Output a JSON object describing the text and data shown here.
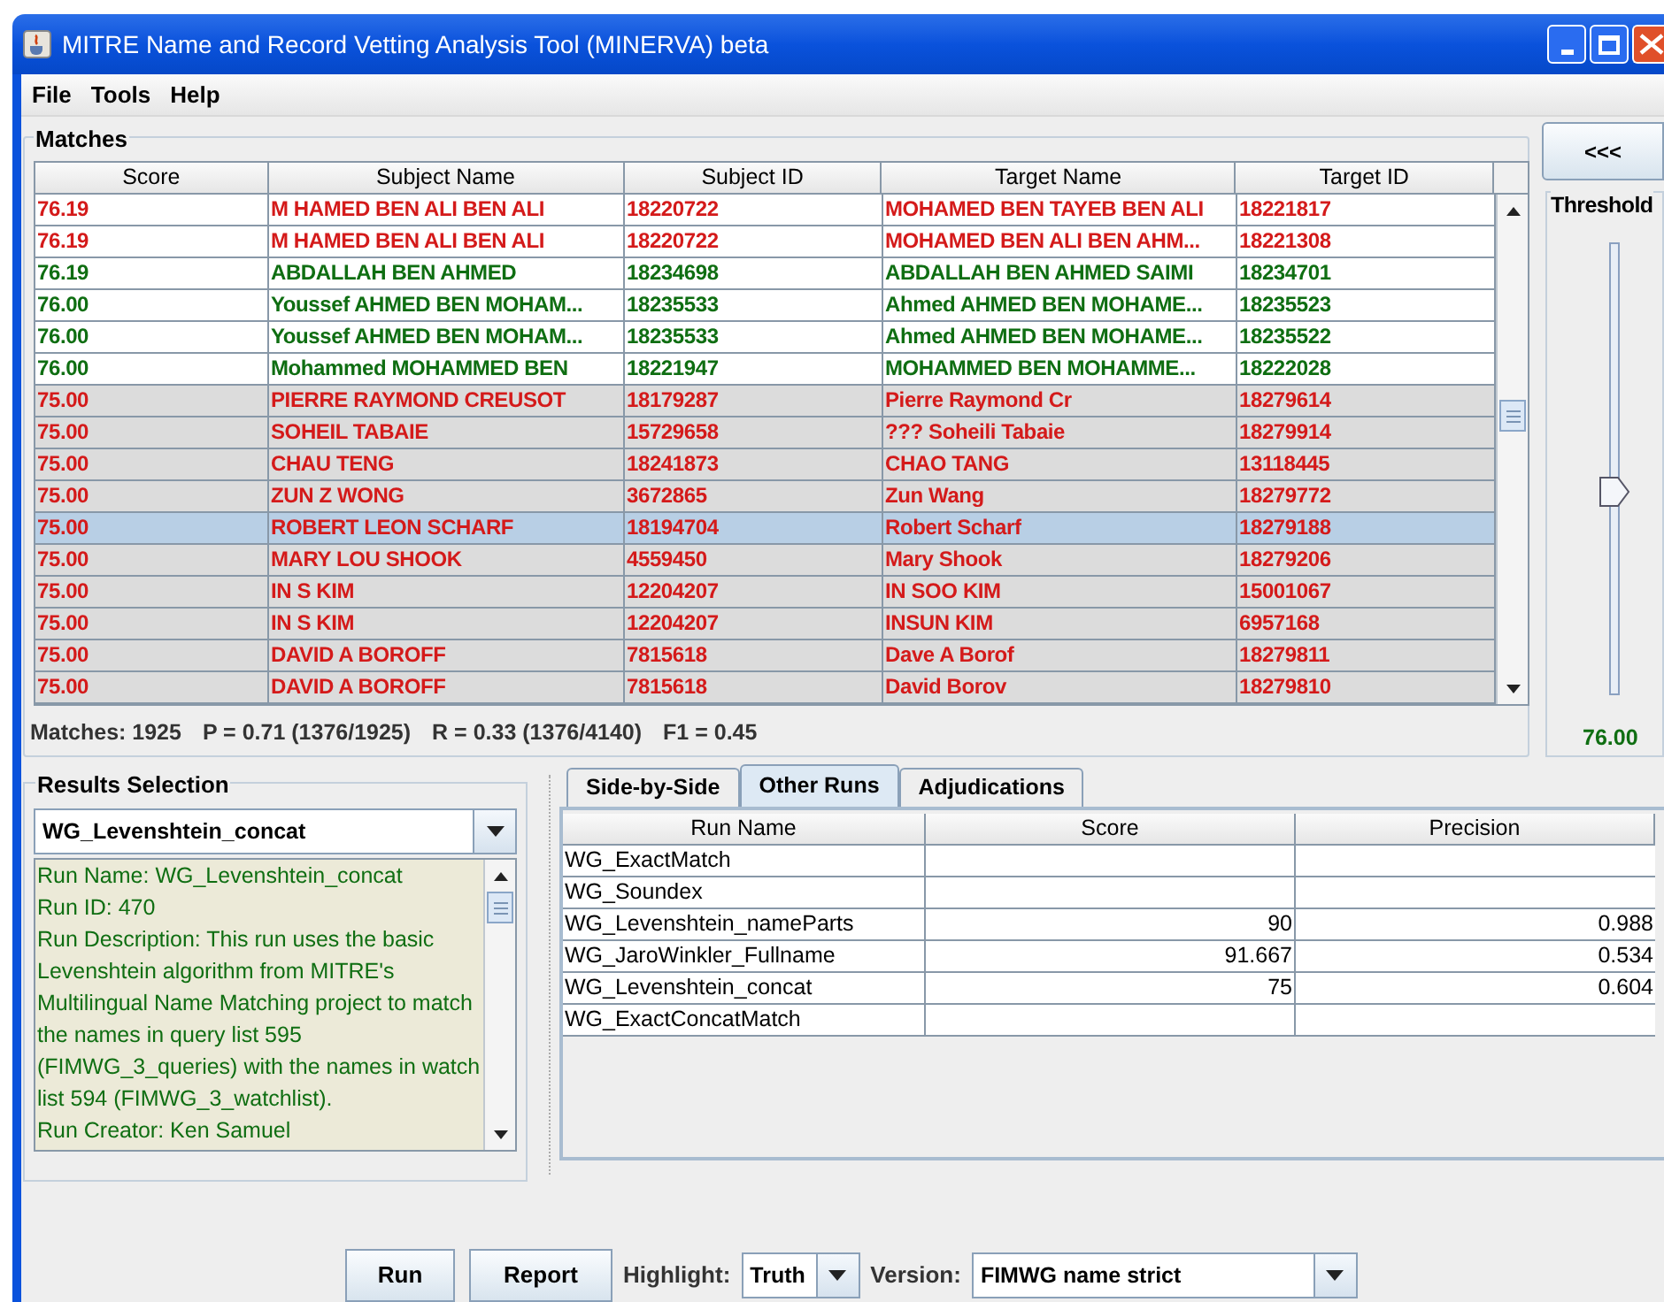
{
  "window": {
    "title": "MITRE Name and Record Vetting Analysis Tool (MINERVA) beta"
  },
  "menu": [
    "File",
    "Tools",
    "Help"
  ],
  "matches": {
    "title": "Matches",
    "columns": [
      "Score",
      "Subject Name",
      "Subject ID",
      "Target Name",
      "Target ID"
    ],
    "rows": [
      {
        "score": "76.19",
        "subject_name": "M HAMED BEN ALI BEN ALI",
        "subject_id": "18220722",
        "target_name": "MOHAMED BEN TAYEB BEN ALI",
        "target_id": "18221817",
        "color": "#d41a1a",
        "shaded": false,
        "selected": false
      },
      {
        "score": "76.19",
        "subject_name": "M HAMED BEN ALI BEN ALI",
        "subject_id": "18220722",
        "target_name": "MOHAMED BEN ALI BEN AHM...",
        "target_id": "18221308",
        "color": "#d41a1a",
        "shaded": false,
        "selected": false
      },
      {
        "score": "76.19",
        "subject_name": "ABDALLAH BEN AHMED",
        "subject_id": "18234698",
        "target_name": "ABDALLAH BEN AHMED SAIMI",
        "target_id": "18234701",
        "color": "#0f6e12",
        "shaded": false,
        "selected": false
      },
      {
        "score": "76.00",
        "subject_name": "Youssef AHMED BEN MOHAM...",
        "subject_id": "18235533",
        "target_name": "Ahmed AHMED BEN MOHAME...",
        "target_id": "18235523",
        "color": "#0f6e12",
        "shaded": false,
        "selected": false
      },
      {
        "score": "76.00",
        "subject_name": "Youssef AHMED BEN MOHAM...",
        "subject_id": "18235533",
        "target_name": "Ahmed AHMED BEN MOHAME...",
        "target_id": "18235522",
        "color": "#0f6e12",
        "shaded": false,
        "selected": false
      },
      {
        "score": "76.00",
        "subject_name": "Mohammed MOHAMMED BEN",
        "subject_id": "18221947",
        "target_name": "MOHAMMED BEN MOHAMME...",
        "target_id": "18222028",
        "color": "#0f6e12",
        "shaded": false,
        "selected": false
      },
      {
        "score": "75.00",
        "subject_name": "PIERRE RAYMOND CREUSOT",
        "subject_id": "18179287",
        "target_name": "Pierre Raymond Cr",
        "target_id": "18279614",
        "color": "#d41a1a",
        "shaded": true,
        "selected": false
      },
      {
        "score": "75.00",
        "subject_name": "SOHEIL TABAIE",
        "subject_id": "15729658",
        "target_name": "??? Soheili Tabaie",
        "target_id": "18279914",
        "color": "#d41a1a",
        "shaded": true,
        "selected": false
      },
      {
        "score": "75.00",
        "subject_name": "CHAU TENG",
        "subject_id": "18241873",
        "target_name": "CHAO TANG",
        "target_id": "13118445",
        "color": "#d41a1a",
        "shaded": true,
        "selected": false
      },
      {
        "score": "75.00",
        "subject_name": "ZUN Z WONG",
        "subject_id": "3672865",
        "target_name": "Zun Wang",
        "target_id": "18279772",
        "color": "#d41a1a",
        "shaded": true,
        "selected": false
      },
      {
        "score": "75.00",
        "subject_name": "ROBERT LEON SCHARF",
        "subject_id": "18194704",
        "target_name": "Robert Scharf",
        "target_id": "18279188",
        "color": "#d41a1a",
        "shaded": true,
        "selected": true
      },
      {
        "score": "75.00",
        "subject_name": "MARY LOU SHOOK",
        "subject_id": "4559450",
        "target_name": "Mary Shook",
        "target_id": "18279206",
        "color": "#d41a1a",
        "shaded": true,
        "selected": false
      },
      {
        "score": "75.00",
        "subject_name": "IN S KIM",
        "subject_id": "12204207",
        "target_name": "IN SOO KIM",
        "target_id": "15001067",
        "color": "#d41a1a",
        "shaded": true,
        "selected": false
      },
      {
        "score": "75.00",
        "subject_name": "IN S KIM",
        "subject_id": "12204207",
        "target_name": "INSUN KIM",
        "target_id": "6957168",
        "color": "#d41a1a",
        "shaded": true,
        "selected": false
      },
      {
        "score": "75.00",
        "subject_name": "DAVID A BOROFF",
        "subject_id": "7815618",
        "target_name": "Dave A Borof",
        "target_id": "18279811",
        "color": "#d41a1a",
        "shaded": true,
        "selected": false
      },
      {
        "score": "75.00",
        "subject_name": "DAVID A BOROFF",
        "subject_id": "7815618",
        "target_name": "David Borov",
        "target_id": "18279810",
        "color": "#d41a1a",
        "shaded": true,
        "selected": false
      }
    ],
    "stats": [
      "Matches: 1925",
      "P = 0.71 (1376/1925)",
      "R = 0.33 (1376/4140)",
      "F1 = 0.45"
    ]
  },
  "collapse_button": "<<<",
  "threshold": {
    "title": "Threshold",
    "level": 0.45,
    "reading": "76.00"
  },
  "results_selection": {
    "title": "Results Selection",
    "run": "WG_Levenshtein_concat",
    "details": [
      "Run Name: WG_Levenshtein_concat",
      "Run ID: 470",
      "Run Description: This run uses the basic Levenshtein algorithm from MITRE's Multilingual Name Matching project to match the names in query list 595 (FIMWG_3_queries) with the names in watch list 594 (FIMWG_3_watchlist).",
      "Run Creator: Ken Samuel"
    ]
  },
  "tabs": [
    {
      "label": "Side-by-Side",
      "selected": false
    },
    {
      "label": "Other Runs",
      "selected": true
    },
    {
      "label": "Adjudications",
      "selected": false
    }
  ],
  "runs_table": {
    "columns": [
      "Run Name",
      "Score",
      "Precision"
    ],
    "rows": [
      {
        "run_name": "WG_ExactMatch"
      },
      {
        "run_name": "WG_Soundex"
      },
      {
        "run_name": "WG_Levenshtein_nameParts",
        "score": "90",
        "precision": "0.988"
      },
      {
        "run_name": "WG_JaroWinkler_Fullname",
        "score": "91.667",
        "precision": "0.534"
      },
      {
        "run_name": "WG_Levenshtein_concat",
        "score": "75",
        "precision": "0.604"
      },
      {
        "run_name": "WG_ExactConcatMatch"
      }
    ]
  },
  "controls": {
    "run": "Run",
    "report": "Report",
    "highlight_label": "Highlight:",
    "highlight": "Truth",
    "version_label": "Version:",
    "version": "FIMWG name strict"
  }
}
